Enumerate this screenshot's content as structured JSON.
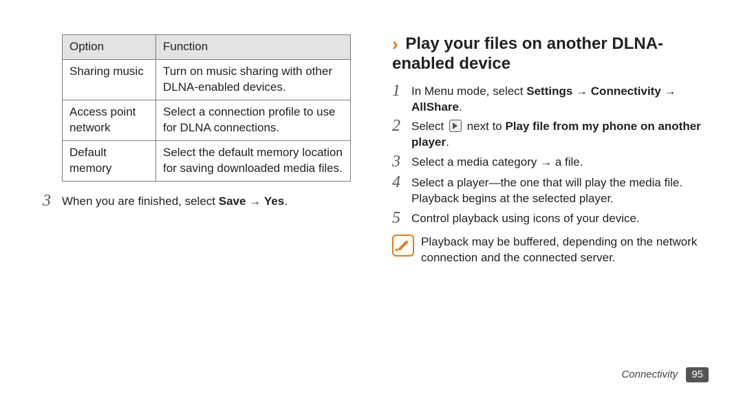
{
  "table": {
    "headers": {
      "option": "Option",
      "function": "Function"
    },
    "rows": [
      {
        "option": "Sharing music",
        "function": "Turn on music sharing with other DLNA-enabled devices."
      },
      {
        "option": "Access point network",
        "function": "Select a connection profile to use for DLNA connections."
      },
      {
        "option": "Default memory",
        "function": "Select the default memory location for saving downloaded media files."
      }
    ]
  },
  "left_step": {
    "num": "3",
    "text_pre": "When you are finished, select ",
    "bold1": "Save",
    "arrow": " → ",
    "bold2": "Yes",
    "text_post": "."
  },
  "heading": "Play your files on another DLNA-enabled device",
  "steps": [
    {
      "num": "1",
      "frags": [
        {
          "t": "In Menu mode, select "
        },
        {
          "t": "Settings",
          "b": true
        },
        {
          "t": " → "
        },
        {
          "t": "Connectivity",
          "b": true
        },
        {
          "t": " → "
        },
        {
          "t": "AllShare",
          "b": true
        },
        {
          "t": "."
        }
      ]
    },
    {
      "num": "2",
      "frags": [
        {
          "t": "Select "
        },
        {
          "icon": "play-circle-icon"
        },
        {
          "t": " next to "
        },
        {
          "t": "Play file from my phone on another player",
          "b": true
        },
        {
          "t": "."
        }
      ]
    },
    {
      "num": "3",
      "frags": [
        {
          "t": "Select a media category → a file."
        }
      ]
    },
    {
      "num": "4",
      "frags": [
        {
          "t": "Select a player—the one that will play the media file. Playback begins at the selected player."
        }
      ]
    },
    {
      "num": "5",
      "frags": [
        {
          "t": "Control playback using icons of your device."
        }
      ]
    }
  ],
  "note": "Playback may be buffered, depending on the network connection and the connected server.",
  "footer": {
    "section": "Connectivity",
    "page": "95"
  }
}
